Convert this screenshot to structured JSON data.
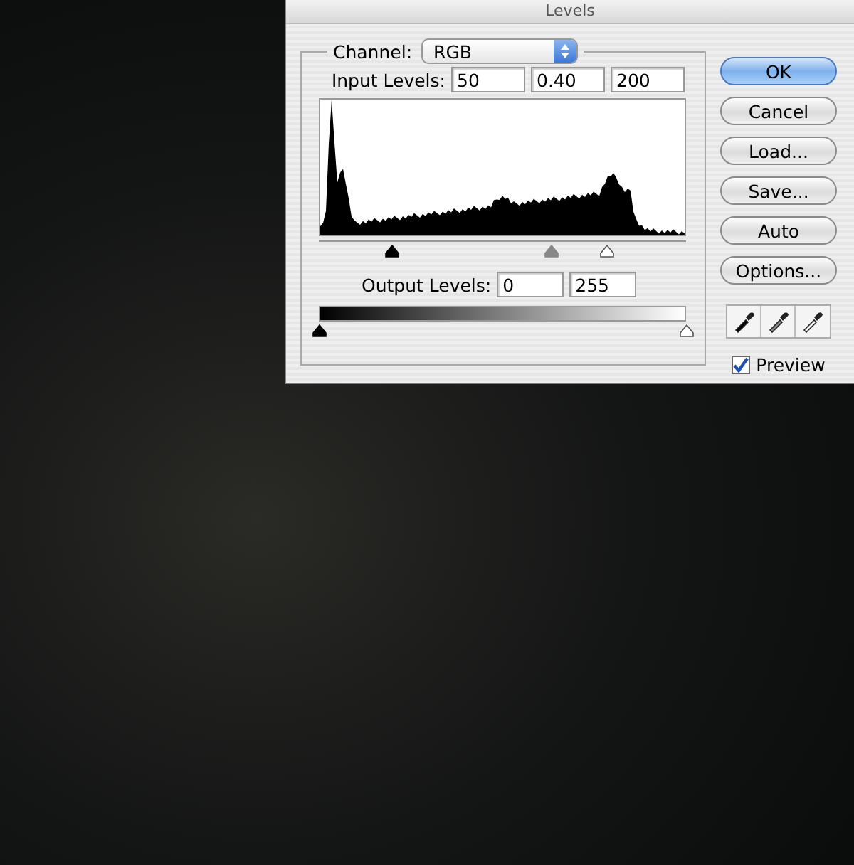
{
  "window": {
    "title": "Levels"
  },
  "channel": {
    "label": "Channel:",
    "value": "RGB"
  },
  "input_levels": {
    "label": "Input Levels:",
    "values": [
      "50",
      "0.40",
      "200"
    ]
  },
  "input_sliders": [
    {
      "kind": "black",
      "level": 0.196
    },
    {
      "kind": "gray",
      "level": 0.63
    },
    {
      "kind": "white",
      "level": 0.784
    }
  ],
  "output_levels": {
    "label": "Output Levels:",
    "values": [
      "0",
      "255"
    ]
  },
  "output_sliders": [
    {
      "kind": "black",
      "level": 0
    },
    {
      "kind": "white",
      "level": 1
    }
  ],
  "buttons": [
    {
      "label": "OK",
      "default": true
    },
    {
      "label": "Cancel",
      "default": false
    },
    {
      "label": "Load...",
      "default": false
    },
    {
      "label": "Save...",
      "default": false
    },
    {
      "label": "Auto",
      "default": false
    },
    {
      "label": "Options...",
      "default": false
    }
  ],
  "eyedroppers": [
    {
      "kind": "black"
    },
    {
      "kind": "gray"
    },
    {
      "kind": "white"
    }
  ],
  "preview": {
    "label": "Preview",
    "checked": true
  }
}
